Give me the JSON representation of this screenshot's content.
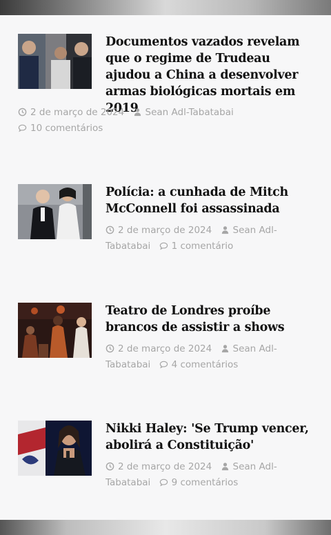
{
  "articles": [
    {
      "title": "Documentos vazados revelam que o regime de Trudeau ajudou a China a desenvolver armas biológicas mortais em 2019",
      "date": "2 de março de 2024",
      "author": "Sean Adl-Tabatabai",
      "comments": "10 comentários"
    },
    {
      "title": "Polícia: a cunhada de Mitch McConnell foi assassinada",
      "date": "2 de março de 2024",
      "author_part1": "Sean Adl-",
      "author_part2": "Tabatabai",
      "comments": "1 comentário"
    },
    {
      "title": "Teatro de Londres proíbe brancos de assistir a shows",
      "date": "2 de março de 2024",
      "author_part1": "Sean Adl-",
      "author_part2": "Tabatabai",
      "comments": "4 comentários"
    },
    {
      "title": "Nikki Haley: 'Se Trump vencer, abolirá a Constituição'",
      "date": "2 de março de 2024",
      "author_part1": "Sean Adl-",
      "author_part2": "Tabatabai",
      "comments": "9 comentários"
    }
  ],
  "icons": {
    "date": "clock-icon",
    "author": "user-icon",
    "comments": "comment-icon"
  },
  "colors": {
    "meta_text": "#a6a6a6",
    "title_text": "#111111",
    "background": "#f7f7f8"
  }
}
